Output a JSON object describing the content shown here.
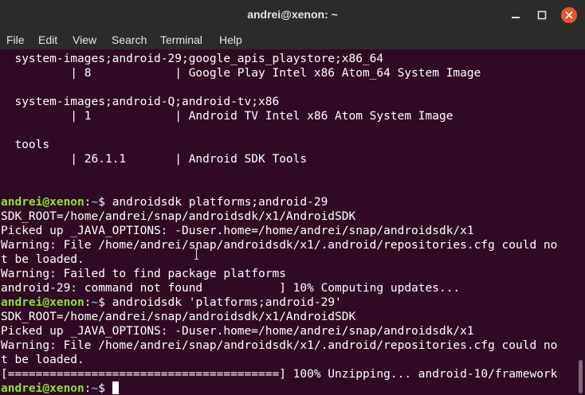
{
  "window": {
    "title": "andrei@xenon: ~",
    "controls": {
      "minimize_icon": "minimize-icon",
      "maximize_icon": "maximize-icon",
      "close_icon": "close-icon",
      "close_color": "#e9552b"
    }
  },
  "menubar": {
    "items": [
      {
        "label": "File"
      },
      {
        "label": "Edit"
      },
      {
        "label": "View"
      },
      {
        "label": "Search"
      },
      {
        "label": "Terminal"
      },
      {
        "label": "Help"
      }
    ]
  },
  "colors": {
    "background": "#300a24",
    "text": "#ffffff",
    "prompt_user": "#8ae234",
    "prompt_path": "#729fcf"
  },
  "terminal": {
    "prompt": {
      "user": "andrei@xenon",
      "sep": ":",
      "path": "~",
      "symbol": "$ "
    },
    "lines": [
      {
        "text": "  system-images;android-29;google_apis_playstore;x86_64"
      },
      {
        "text": "          | 8            | Google Play Intel x86 Atom_64 System Image"
      },
      {
        "text": ""
      },
      {
        "text": "  system-images;android-Q;android-tv;x86"
      },
      {
        "text": "          | 1            | Android TV Intel x86 Atom System Image"
      },
      {
        "text": ""
      },
      {
        "text": "  tools"
      },
      {
        "text": "          | 26.1.1       | Android SDK Tools"
      },
      {
        "text": ""
      },
      {
        "text": ""
      },
      {
        "prompt": true,
        "text": "androidsdk platforms;android-29"
      },
      {
        "text": "SDK_ROOT=/home/andrei/snap/androidsdk/x1/AndroidSDK"
      },
      {
        "text": "Picked up _JAVA_OPTIONS: -Duser.home=/home/andrei/snap/androidsdk/x1"
      },
      {
        "text": "Warning: File /home/andrei/snap/androidsdk/x1/.android/repositories.cfg could no"
      },
      {
        "text": "t be loaded."
      },
      {
        "text": "Warning: Failed to find package platforms"
      },
      {
        "text": "android-29: command not found           ] 10% Computing updates..."
      },
      {
        "prompt": true,
        "text": "androidsdk 'platforms;android-29'"
      },
      {
        "text": "SDK_ROOT=/home/andrei/snap/androidsdk/x1/AndroidSDK"
      },
      {
        "text": "Picked up _JAVA_OPTIONS: -Duser.home=/home/andrei/snap/androidsdk/x1"
      },
      {
        "text": "Warning: File /home/andrei/snap/androidsdk/x1/.android/repositories.cfg could no"
      },
      {
        "text": "t be loaded."
      },
      {
        "text": "[=======================================] 100% Unzipping... android-10/framework"
      },
      {
        "prompt": true,
        "text": "",
        "cursor": true
      }
    ]
  }
}
